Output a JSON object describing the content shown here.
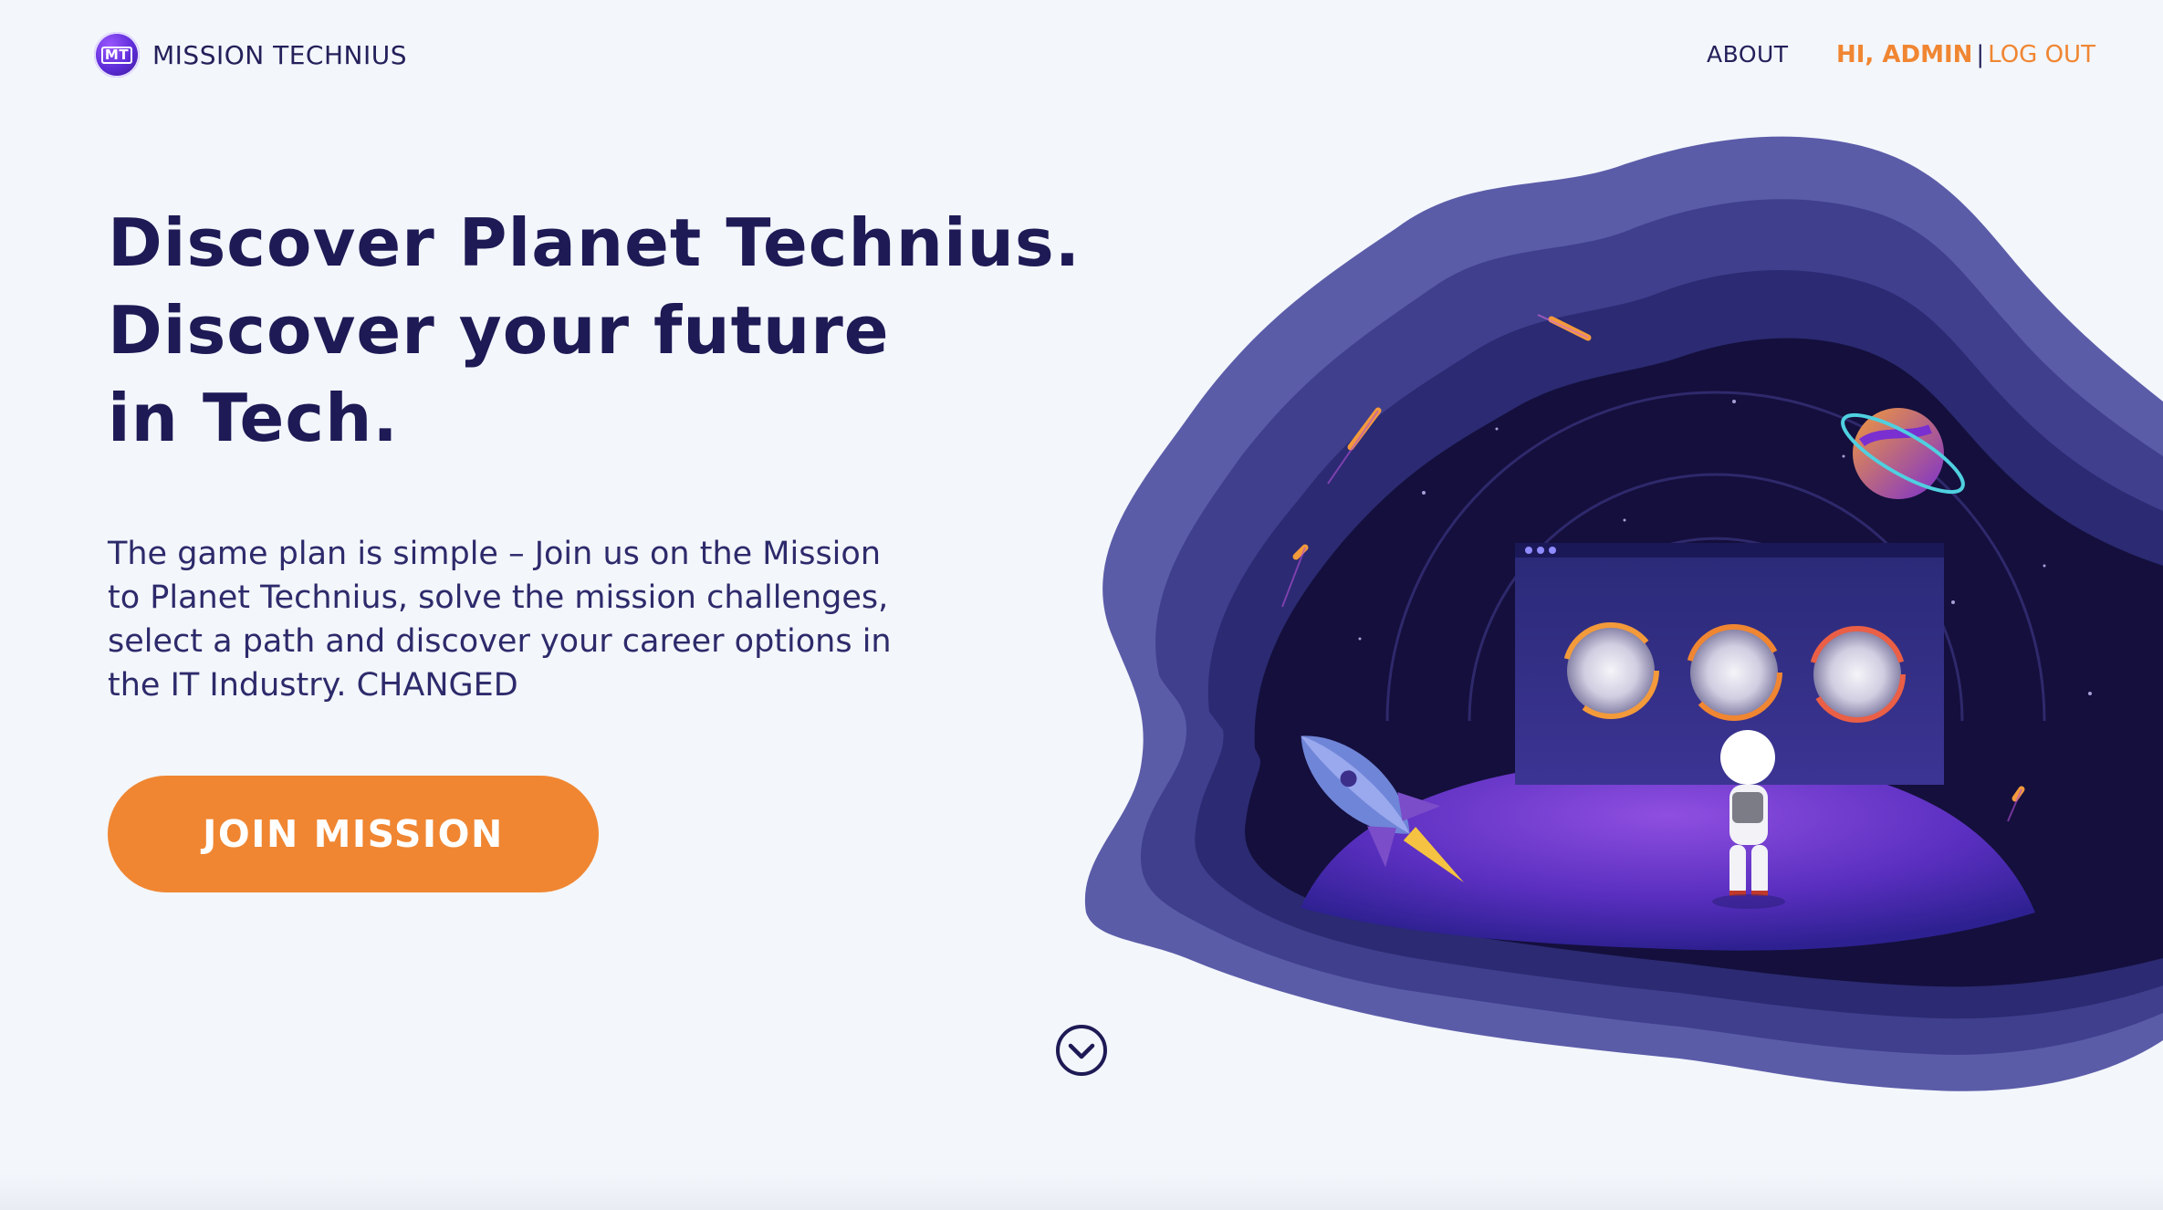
{
  "header": {
    "brand_mark": "MT",
    "brand_name": "MISSION TECHNIUS",
    "nav_about": "ABOUT",
    "greeting": "HI, ADMIN",
    "separator": "|",
    "logout": "LOG OUT"
  },
  "hero": {
    "headline_line1": "Discover Planet Technius.",
    "headline_line2": "Discover your future",
    "headline_line3": "in Tech.",
    "description": "The game plan is simple – Join us on the Mission to Planet Technius, solve the mission challenges, select a path and discover your career options in the IT Industry. CHANGED",
    "cta_label": "JOIN MISSION"
  },
  "icons": {
    "logo": "mission-technius-logo",
    "scroll": "chevron-down-circle-icon"
  },
  "colors": {
    "accent": "#f08632",
    "heading": "#1d1a55",
    "background": "#f3f6fb",
    "illustration_outer": "#5b5ca8",
    "illustration_inner": "#140f3c"
  }
}
